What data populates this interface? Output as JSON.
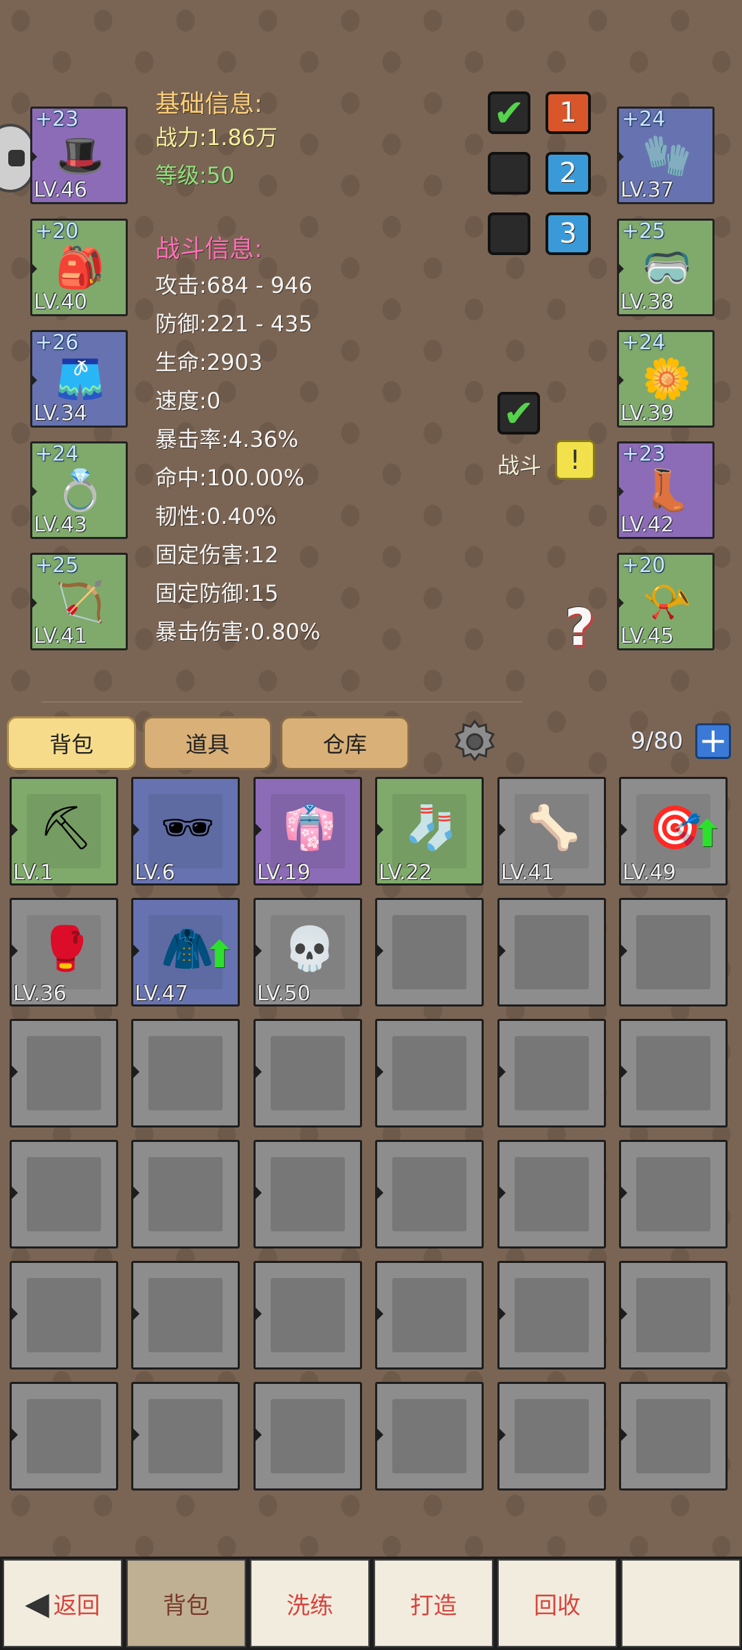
{
  "equipment_left": [
    {
      "plus": "+23",
      "lv": "LV.46",
      "color": "#8c6cb6",
      "icon": "witch-hat-icon"
    },
    {
      "plus": "+20",
      "lv": "LV.40",
      "color": "#7faa6b",
      "icon": "backpack-armor-icon"
    },
    {
      "plus": "+26",
      "lv": "LV.34",
      "color": "#6773b0",
      "icon": "shorts-icon"
    },
    {
      "plus": "+24",
      "lv": "LV.43",
      "color": "#7faa6b",
      "icon": "ring-icon"
    },
    {
      "plus": "+25",
      "lv": "LV.41",
      "color": "#7faa6b",
      "icon": "bow-icon"
    }
  ],
  "equipment_right": [
    {
      "plus": "+24",
      "lv": "LV.37",
      "color": "#6773b0",
      "icon": "gloves-icon"
    },
    {
      "plus": "+25",
      "lv": "LV.38",
      "color": "#7faa6b",
      "icon": "mask-icon"
    },
    {
      "plus": "+24",
      "lv": "LV.39",
      "color": "#7faa6b",
      "icon": "flower-shield-icon"
    },
    {
      "plus": "+23",
      "lv": "LV.42",
      "color": "#8c6cb6",
      "icon": "boots-icon"
    },
    {
      "plus": "+20",
      "lv": "LV.45",
      "color": "#7faa6b",
      "icon": "horn-icon"
    }
  ],
  "basic_info": {
    "title": "基础信息:",
    "power": "战力:1.86万",
    "level": "等级:50"
  },
  "battle_info": {
    "title": "战斗信息:",
    "lines": [
      "攻击:684 - 946",
      "防御:221 - 435",
      "生命:2903",
      "速度:0",
      "暴击率:4.36%",
      "命中:100.00%",
      "韧性:0.40%",
      "固定伤害:12",
      "固定防御:15",
      "暴击伤害:0.80%"
    ]
  },
  "presets": [
    {
      "checked": true,
      "num": "1",
      "color": "#d8562a"
    },
    {
      "checked": false,
      "num": "2",
      "color": "#3a9ad8"
    },
    {
      "checked": false,
      "num": "3",
      "color": "#3a9ad8"
    }
  ],
  "battle_toggle": {
    "label": "战斗",
    "checked": true,
    "alert": "!"
  },
  "help": "?",
  "tabs": [
    "背包",
    "道具",
    "仓库"
  ],
  "capacity": "9/80",
  "inventory": [
    {
      "lv": "LV.1",
      "color": "#7faa6b",
      "icon": "pickaxe-icon",
      "up": false
    },
    {
      "lv": "LV.6",
      "color": "#6773b0",
      "icon": "goggles-icon",
      "up": false
    },
    {
      "lv": "LV.19",
      "color": "#8c6cb6",
      "icon": "robe-icon",
      "up": false
    },
    {
      "lv": "LV.22",
      "color": "#7faa6b",
      "icon": "socks-icon",
      "up": false
    },
    {
      "lv": "LV.41",
      "color": "#8d8d8d",
      "icon": "bone-claw-icon",
      "up": false
    },
    {
      "lv": "LV.49",
      "color": "#8d8d8d",
      "icon": "quiver-icon",
      "up": true
    },
    {
      "lv": "LV.36",
      "color": "#8d8d8d",
      "icon": "fist-glove-icon",
      "up": false
    },
    {
      "lv": "LV.47",
      "color": "#6773b0",
      "icon": "jacket-icon",
      "up": true
    },
    {
      "lv": "LV.50",
      "color": "#8d8d8d",
      "icon": "skull-armor-icon",
      "up": false
    }
  ],
  "bottom_tabs": [
    "返回",
    "背包",
    "洗练",
    "打造",
    "回收",
    ""
  ]
}
